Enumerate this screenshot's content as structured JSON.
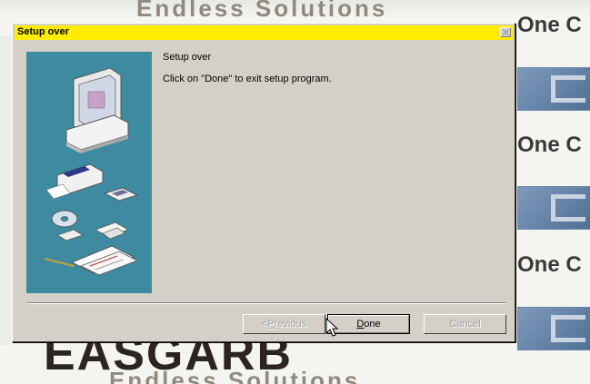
{
  "wallpaper": {
    "top_text": "Endless Solutions",
    "bottom_text": "Endless Solutions",
    "right_texts": [
      "One C",
      "One C",
      "One C"
    ],
    "big_letters": "EASGARB"
  },
  "dialog": {
    "title": "Setup over",
    "heading": "Setup over",
    "message": "Click on \"Done\" to exit setup program.",
    "buttons": {
      "previous": {
        "accel": "P",
        "rest": "revious",
        "prefix": "< ",
        "enabled": false
      },
      "done": {
        "accel": "D",
        "rest": "one",
        "enabled": true
      },
      "cancel": {
        "label": "Cancel",
        "enabled": false
      }
    }
  },
  "colors": {
    "titlebar": "#ffec00",
    "dialog_face": "#d4d0c8",
    "picture_panel": "#3e8ba1"
  },
  "icons": [
    "close-icon",
    "computer-icon",
    "printer-icon",
    "disk-icon",
    "cd-icon",
    "documents-icon",
    "pointer-cursor-icon"
  ]
}
